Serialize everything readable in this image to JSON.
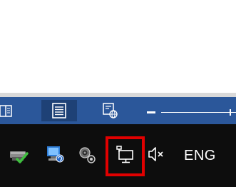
{
  "statusbar": {
    "views": [
      "read-mode",
      "print-layout",
      "web-layout"
    ],
    "active_view": "print-layout"
  },
  "taskbar": {
    "tray_icons": [
      "printer-check-icon",
      "network-sync-icon",
      "speaker-settings-icon",
      "network-icon",
      "volume-muted-icon"
    ],
    "language": "ENG"
  },
  "colors": {
    "word_blue": "#2b579a",
    "taskbar": "#0d0d0d",
    "highlight": "#e00000"
  }
}
